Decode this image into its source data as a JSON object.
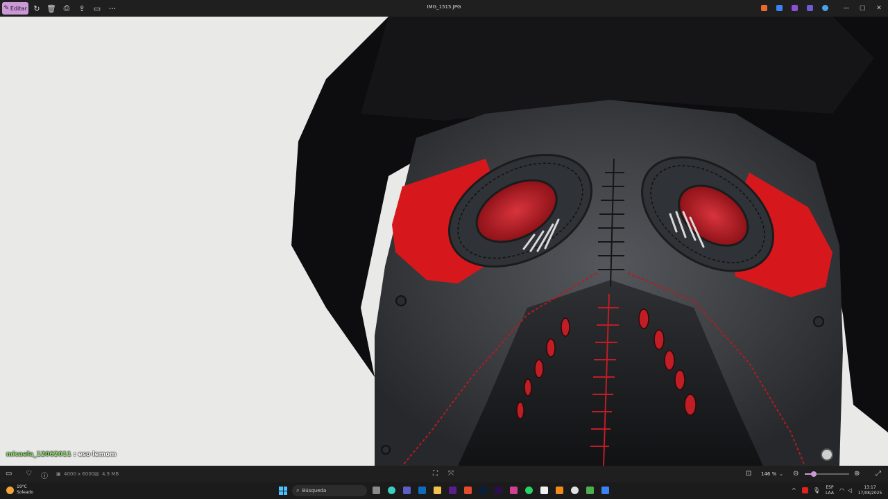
{
  "toolbar": {
    "edit_label": "Editar",
    "title": "IMG_1515.JPG"
  },
  "chat": {
    "user": "micaela_12062011",
    "message": "eso lemom"
  },
  "statusbar": {
    "dimensions": "4000 x 6000",
    "file_size": "4,9 MB",
    "zoom": "146 %",
    "zoom_fraction": 0.2
  },
  "taskbar": {
    "weather_temp": "19°C",
    "weather_desc": "Soleado",
    "search_placeholder": "Búsqueda",
    "lang_1": "ESP",
    "lang_2": "LAA",
    "time": "13:17",
    "date": "17/08/2025"
  },
  "colors": {
    "accent": "#c99ad6",
    "mask_red": "#d6181c",
    "mask_body": "#3a3c3f",
    "hat": "#0d0d0f",
    "background": "#e9e9e8"
  }
}
